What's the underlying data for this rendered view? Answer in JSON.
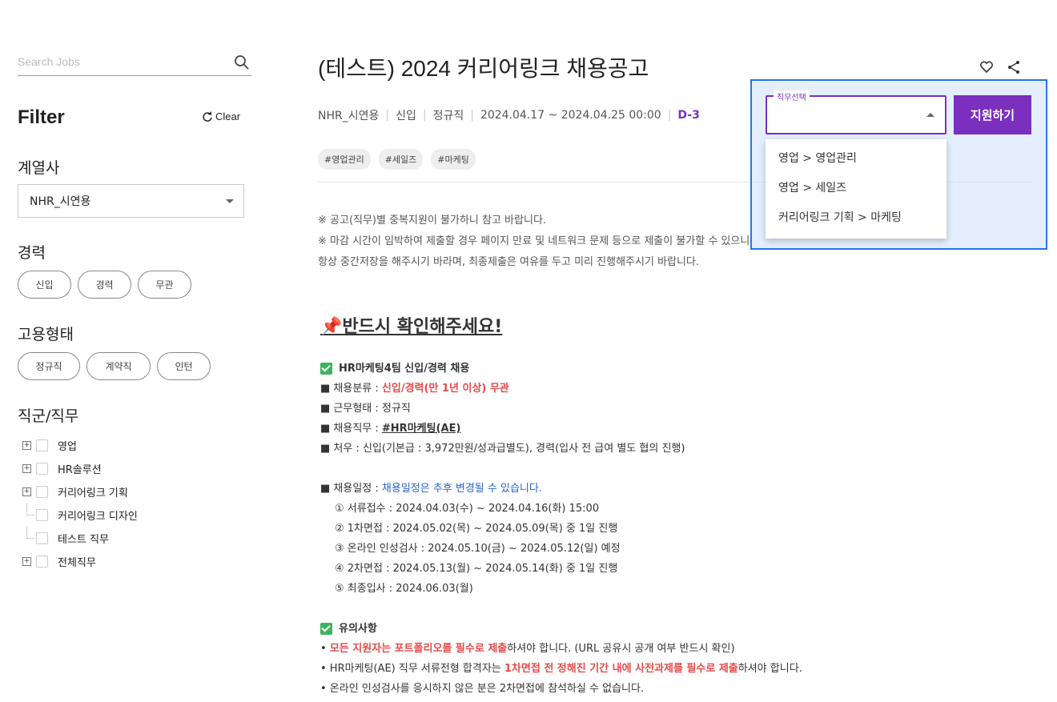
{
  "search": {
    "placeholder": "Search Jobs"
  },
  "filter": {
    "title": "Filter",
    "clear_label": "Clear"
  },
  "affiliate": {
    "title": "계열사",
    "selected": "NHR_시연용"
  },
  "career": {
    "title": "경력",
    "options": [
      "신입",
      "경력",
      "무관"
    ]
  },
  "employment": {
    "title": "고용형태",
    "options": [
      "정규직",
      "계약직",
      "인턴"
    ]
  },
  "jobs": {
    "title": "직군/직무",
    "items": [
      {
        "label": "영업",
        "expandable": true
      },
      {
        "label": "HR솔루션",
        "expandable": true
      },
      {
        "label": "커리어링크 기획",
        "expandable": true
      },
      {
        "label": "커리어링크 디자인",
        "expandable": false
      },
      {
        "label": "테스트 직무",
        "expandable": false
      },
      {
        "label": "전체직무",
        "expandable": true
      }
    ]
  },
  "posting": {
    "title": "(테스트) 2024 커리어링크 채용공고",
    "company": "NHR_시연용",
    "level": "신입",
    "type": "정규직",
    "period": "2024.04.17 ~ 2024.04.25 00:00",
    "dday": "D-3",
    "tags": [
      "#영업관리",
      "#세일즈",
      "#마케팅"
    ],
    "notice": [
      "※ 공고(직무)별 중복지원이 불가하니 참고 바랍니다.",
      "※ 마감 시간이 임박하여 제출할 경우 페이지 만료 및 네트워크 문제 등으로 제출이 불가할 수 있으니",
      "항상 중간저장을 해주시기 바라며, 최종제출은 여유를 두고 미리 진행해주시기 바랍니다."
    ],
    "must_check": "📌반드시 확인해주세요!",
    "section1": {
      "head": "HR마케팅4팀 신입/경력 채용",
      "cat_label": "■ 채용분류 : ",
      "cat_value": "신입/경력(만 1년 이상) 무관",
      "work_type": "■ 근무형태 : 정규직",
      "role_label": "■ 채용직무 : ",
      "role_value": "#HR마케팅(AE)",
      "pay": "■ 처우 : 신입(기본급 : 3,972만원/성과급별도), 경력(입사 전 급여 별도 협의 진행)",
      "schedule_label": "■ 채용일정 : ",
      "schedule_note": "채용일정은 추후 변경될 수 있습니다.",
      "steps": [
        "① 서류접수 : 2024.04.03(수) ~ 2024.04.16(화) 15:00",
        "② 1차면접 : 2024.05.02(목) ~ 2024.05.09(목) 중 1일 진행",
        "③ 온라인 인성검사 : 2024.05.10(금) ~ 2024.05.12(일) 예정",
        "④ 2차면접 : 2024.05.13(월) ~ 2024.05.14(화) 중 1일 진행",
        "⑤ 최종입사 : 2024.06.03(월)"
      ]
    },
    "section2": {
      "head": "유의사항",
      "l1_pre": "• ",
      "l1_red": "모든 지원자는 포트폴리오를 필수로 제출",
      "l1_post": "하셔야 합니다. (URL 공유시 공개 여부 반드시 확인)",
      "l2_pre": "• HR마케팅(AE) 직무 서류전형 합격자는 ",
      "l2_red": "1차면접 전 정해진 기간 내에 사전과제를 필수로 제출",
      "l2_post": "하셔야 합니다.",
      "l3": "• 온라인 인성검사를 응시하지 않은 분은 2차면접에 참석하실 수 없습니다."
    }
  },
  "apply": {
    "select_legend": "직무선택",
    "button_label": "지원하기",
    "options": [
      "영업 > 영업관리",
      "영업 > 세일즈",
      "커리어링크 기획 > 마케팅"
    ]
  },
  "colors": {
    "accent": "#7b2fbf",
    "highlight_border": "#2277e6",
    "red": "#e84a4a",
    "blue": "#2a64c9",
    "green": "#3cb55e"
  }
}
